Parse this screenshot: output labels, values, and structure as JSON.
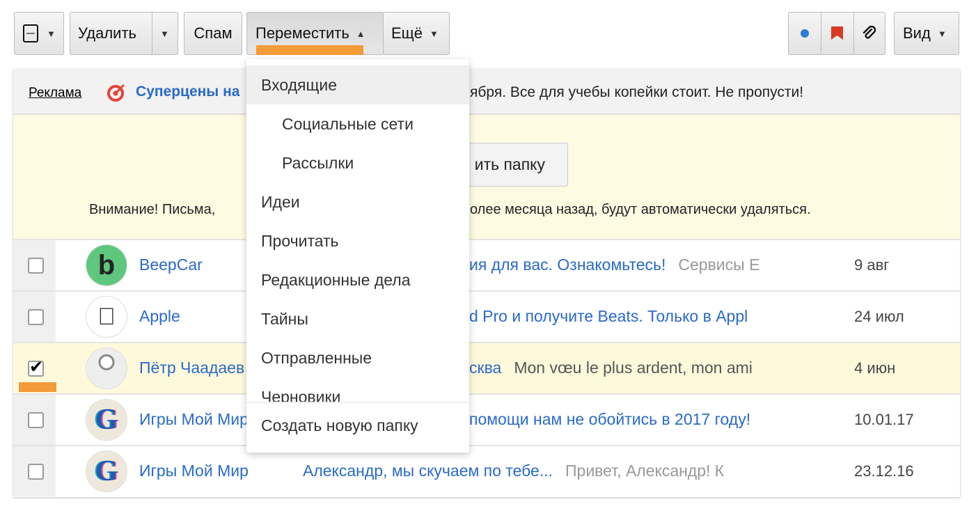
{
  "toolbar": {
    "delete": "Удалить",
    "spam": "Спам",
    "move": "Переместить",
    "more": "Ещё",
    "view": "Вид"
  },
  "colors": {
    "accent": "#f39b38",
    "link": "#2a6ac8",
    "unread_dot": "#2f7bd6",
    "flag": "#d63a22"
  },
  "ad": {
    "label": "Реклама",
    "title": "Суперцены на",
    "tail": "ября. Все для учебы копейки стоит. Не пропусти!"
  },
  "warning": {
    "button_tail": "ить папку",
    "text_head": "Внимание! Письма,",
    "text_tail": "олее месяца назад, будут автоматически удаляться."
  },
  "move_menu": {
    "items": [
      {
        "label": "Входящие"
      },
      {
        "label": "Социальные сети"
      },
      {
        "label": "Рассылки"
      },
      {
        "label": "Идеи"
      },
      {
        "label": "Прочитать"
      },
      {
        "label": "Редакционные дела"
      },
      {
        "label": "Тайны"
      },
      {
        "label": "Отправленные"
      },
      {
        "label": "Черновики"
      }
    ],
    "create": "Создать новую папку"
  },
  "messages": [
    {
      "sender": "BeepCar",
      "subject": "ия для вас. Ознакомьтесь!",
      "preview": "Сервисы Е",
      "date": "9 авг",
      "checked": false
    },
    {
      "sender": "Apple",
      "subject": "d Pro и получите Beats. Только в Appl",
      "preview": "",
      "date": "24 июл",
      "checked": false
    },
    {
      "sender": "Пётр Чаадаев",
      "subject": "сква",
      "preview": "Mon vœu le plus ardent, mon ami",
      "date": "4 июн",
      "checked": true
    },
    {
      "sender": "Игры Мой Мир",
      "subject": " помощи нам не обойтись в 2017 году!",
      "preview": "",
      "date": "10.01.17",
      "checked": false
    },
    {
      "sender": "Игры Мой Мир",
      "subject": "Александр, мы скучаем по тебе...",
      "preview": "Привет, Александр! К",
      "date": "23.12.16",
      "checked": false
    }
  ]
}
